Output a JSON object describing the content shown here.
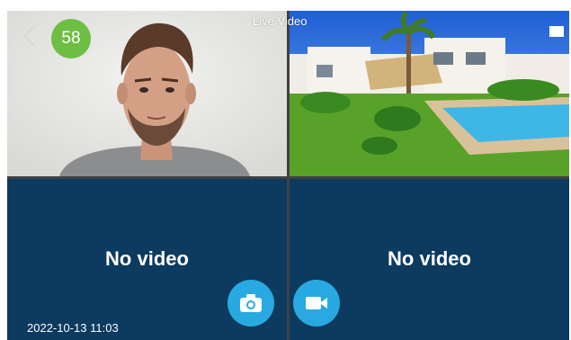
{
  "header": {
    "count_badge": "58",
    "live_label": "Live Video"
  },
  "panes": {
    "bottom_left": {
      "message": "No video",
      "timestamp": "2022-10-13 11:03"
    },
    "bottom_right": {
      "message": "No video"
    }
  },
  "icons": {
    "back": "chevron-left-icon",
    "snapshot": "camera-icon",
    "record": "video-camera-icon",
    "view": "square-icon"
  },
  "colors": {
    "pane_background": "#0d3a5f",
    "action_button": "#29a9e1",
    "badge": "#6fbe44"
  }
}
